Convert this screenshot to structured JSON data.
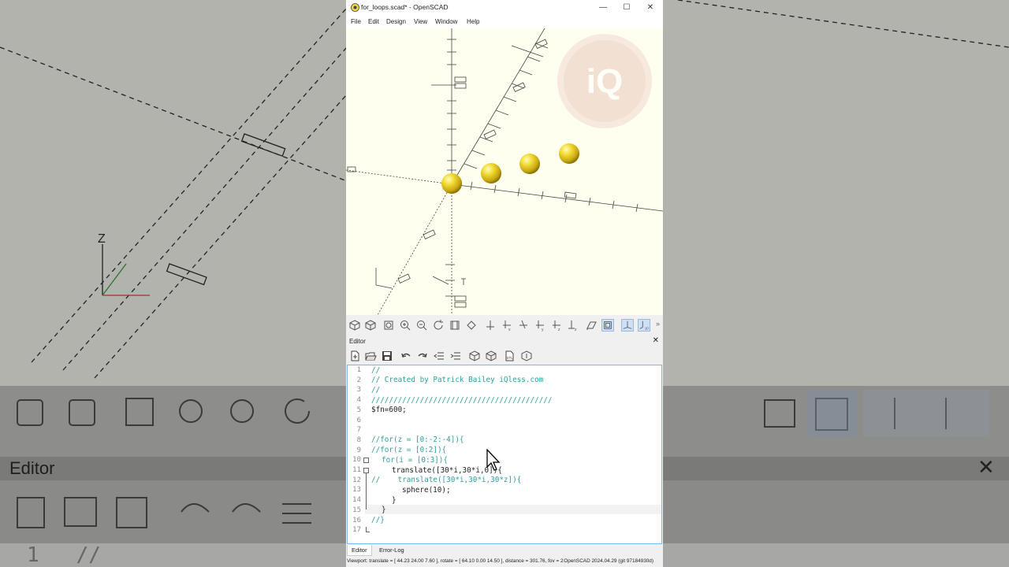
{
  "window": {
    "title": "for_loops.scad* - OpenSCAD",
    "minimize_glyph": "—",
    "maximize_glyph": "☐",
    "close_glyph": "✕"
  },
  "menu": [
    "File",
    "Edit",
    "Design",
    "View",
    "Window",
    "Help"
  ],
  "watermark": "iQ",
  "viewport_toolbar": {
    "icons": [
      "preview-icon",
      "render-icon",
      "view-all-icon",
      "zoom-in-icon",
      "zoom-out-icon",
      "reset-view-icon",
      "view-right-icon",
      "view-diagonal-icon",
      "view-top-icon",
      "view-bottom-icon",
      "view-left-icon",
      "view-front-icon",
      "view-back-icon",
      "view-iso-icon",
      "perspective-icon",
      "orthogonal-icon",
      "show-axes-icon",
      "show-scale-icon"
    ],
    "more_glyph": "»"
  },
  "editor": {
    "title": "Editor",
    "close_glyph": "✕",
    "toolbar_icons": [
      "new-file-icon",
      "open-file-icon",
      "save-file-icon",
      "undo-icon",
      "redo-icon",
      "unindent-icon",
      "indent-icon",
      "preview-icon",
      "render-icon",
      "export-stl-icon",
      "send-to-3d-print-icon"
    ],
    "lines": [
      {
        "n": "1",
        "text": "//",
        "cls": "cm",
        "indent": 0
      },
      {
        "n": "2",
        "text": "// Created by Patrick Bailey iQless.com",
        "cls": "cm",
        "indent": 0
      },
      {
        "n": "3",
        "text": "//",
        "cls": "cm",
        "indent": 0
      },
      {
        "n": "4",
        "text": "/////////////////////////////////////////",
        "cls": "cm",
        "indent": 0
      },
      {
        "n": "5",
        "text": "$fn=600;",
        "cls": "tx",
        "indent": 0
      },
      {
        "n": "6",
        "text": "",
        "cls": "tx",
        "indent": 0
      },
      {
        "n": "7",
        "text": "",
        "cls": "tx",
        "indent": 0
      },
      {
        "n": "8",
        "text": "//for(z = [0:-2:-4]){",
        "cls": "cm",
        "indent": 0
      },
      {
        "n": "9",
        "text": "//for(z = [0:2]){",
        "cls": "cm",
        "indent": 0
      },
      {
        "n": "10",
        "text": "for(i = [0:3]){",
        "cls": "kw",
        "indent": 1
      },
      {
        "n": "11",
        "text": "translate([30*i,30*i,0]){",
        "cls": "tx",
        "indent": 2
      },
      {
        "n": "12",
        "text": "//    translate([30*i,30*i,30*z]){",
        "cls": "cm",
        "indent": 0
      },
      {
        "n": "13",
        "text": "sphere(10);",
        "cls": "tx",
        "indent": 3
      },
      {
        "n": "14",
        "text": "}",
        "cls": "tx",
        "indent": 2
      },
      {
        "n": "15",
        "text": "}",
        "cls": "tx",
        "indent": 1
      },
      {
        "n": "16",
        "text": "//}",
        "cls": "cm",
        "indent": 0
      },
      {
        "n": "17",
        "text": "",
        "cls": "tx",
        "indent": 0
      }
    ]
  },
  "tabs": [
    "Editor",
    "Error-Log"
  ],
  "status": {
    "viewport": "Viewport: translate = [ 44.23 24.00 7.60 ], rotate = [ 64.10 0.00 14.50 ], distance = 301.76, fov = 22.50 (1280x720)",
    "version": "OpenSCAD 2024.04.29 (git 97184930d)"
  },
  "background": {
    "editor_title": "Editor",
    "close_glyph": "✕",
    "line_no": "1",
    "line_text": "//"
  },
  "colors": {
    "viewport_bg": "#fffff0",
    "sphere": "#e8d020",
    "comment": "#2f9e9e",
    "focus_border": "#7eb4ea"
  }
}
